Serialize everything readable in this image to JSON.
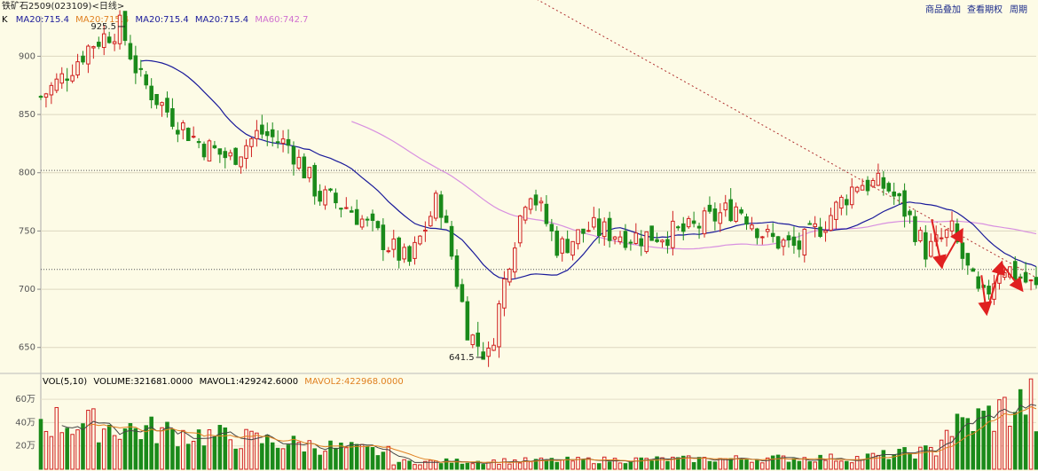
{
  "header": {
    "symbol": "铁矿石2509",
    "code": "(023109)",
    "period": "<日线>",
    "toolbar": [
      "商品叠加",
      "查看期权",
      "周期"
    ]
  },
  "price_legend": [
    {
      "label": "K",
      "color": "#000000"
    },
    {
      "label": "MA20:715.4",
      "color": "#1a1a9a"
    },
    {
      "label": "MA20:715.4",
      "color": "#e08020"
    },
    {
      "label": "MA20:715.4",
      "color": "#1a1a9a"
    },
    {
      "label": "MA20:715.4",
      "color": "#1a1a9a"
    },
    {
      "label": "MA60:742.7",
      "color": "#d070d0"
    }
  ],
  "volume_legend": [
    {
      "label": "VOL(5,10)",
      "color": "#000000"
    },
    {
      "label": "VOLUME:321681.0000",
      "color": "#000000"
    },
    {
      "label": "MAVOL1:429242.6000",
      "color": "#000000"
    },
    {
      "label": "MAVOL2:422968.0000",
      "color": "#e08020"
    }
  ],
  "chart_data": [
    {
      "type": "candlestick",
      "title": "铁矿石2509(023109)<日线>",
      "ylim": [
        630,
        930
      ],
      "y_ticks": [
        650,
        700,
        750,
        800,
        850,
        900
      ],
      "annotations": [
        {
          "text": "925.5",
          "value": 925.5,
          "kind": "high"
        },
        {
          "text": "641.5",
          "value": 641.5,
          "kind": "low"
        }
      ],
      "horizontal_levels": [
        802,
        717
      ],
      "trendline": {
        "from": [
          0.475,
          960
        ],
        "to": [
          1.0,
          710
        ]
      },
      "waypoints": [
        [
          0,
          865
        ],
        [
          0.02,
          880
        ],
        [
          0.05,
          910
        ],
        [
          0.08,
          925.5
        ],
        [
          0.1,
          880
        ],
        [
          0.13,
          850
        ],
        [
          0.16,
          825
        ],
        [
          0.19,
          812
        ],
        [
          0.22,
          835
        ],
        [
          0.25,
          823
        ],
        [
          0.28,
          780
        ],
        [
          0.31,
          770
        ],
        [
          0.34,
          745
        ],
        [
          0.37,
          722
        ],
        [
          0.4,
          780
        ],
        [
          0.42,
          700
        ],
        [
          0.43,
          662
        ],
        [
          0.45,
          641.5
        ],
        [
          0.47,
          725
        ],
        [
          0.49,
          790
        ],
        [
          0.52,
          735
        ],
        [
          0.55,
          752
        ],
        [
          0.6,
          745
        ],
        [
          0.65,
          750
        ],
        [
          0.7,
          772
        ],
        [
          0.73,
          744
        ],
        [
          0.76,
          735
        ],
        [
          0.79,
          760
        ],
        [
          0.82,
          792
        ],
        [
          0.85,
          788
        ],
        [
          0.87,
          765
        ],
        [
          0.89,
          732
        ],
        [
          0.915,
          750
        ],
        [
          0.93,
          718
        ],
        [
          0.945,
          688
        ],
        [
          0.965,
          722
        ],
        [
          1.0,
          700
        ]
      ],
      "count": 190,
      "seed": 7
    },
    {
      "type": "bar",
      "title": "VOL(5,10)",
      "ylim": [
        0,
        700000
      ],
      "y_ticks": [
        "20万",
        "40万",
        "60万"
      ],
      "series": [
        {
          "name": "MAVOL1",
          "value": 429242.6
        },
        {
          "name": "MAVOL2",
          "value": 422968.0
        }
      ],
      "last_volume": 321681.0
    }
  ],
  "arrows_color": "#e02020",
  "arrows": [
    [
      0.895,
      760,
      0.905,
      720
    ],
    [
      0.905,
      720,
      0.925,
      750
    ],
    [
      0.945,
      712,
      0.95,
      680
    ],
    [
      0.95,
      680,
      0.965,
      722
    ],
    [
      0.965,
      722,
      0.985,
      700
    ]
  ]
}
